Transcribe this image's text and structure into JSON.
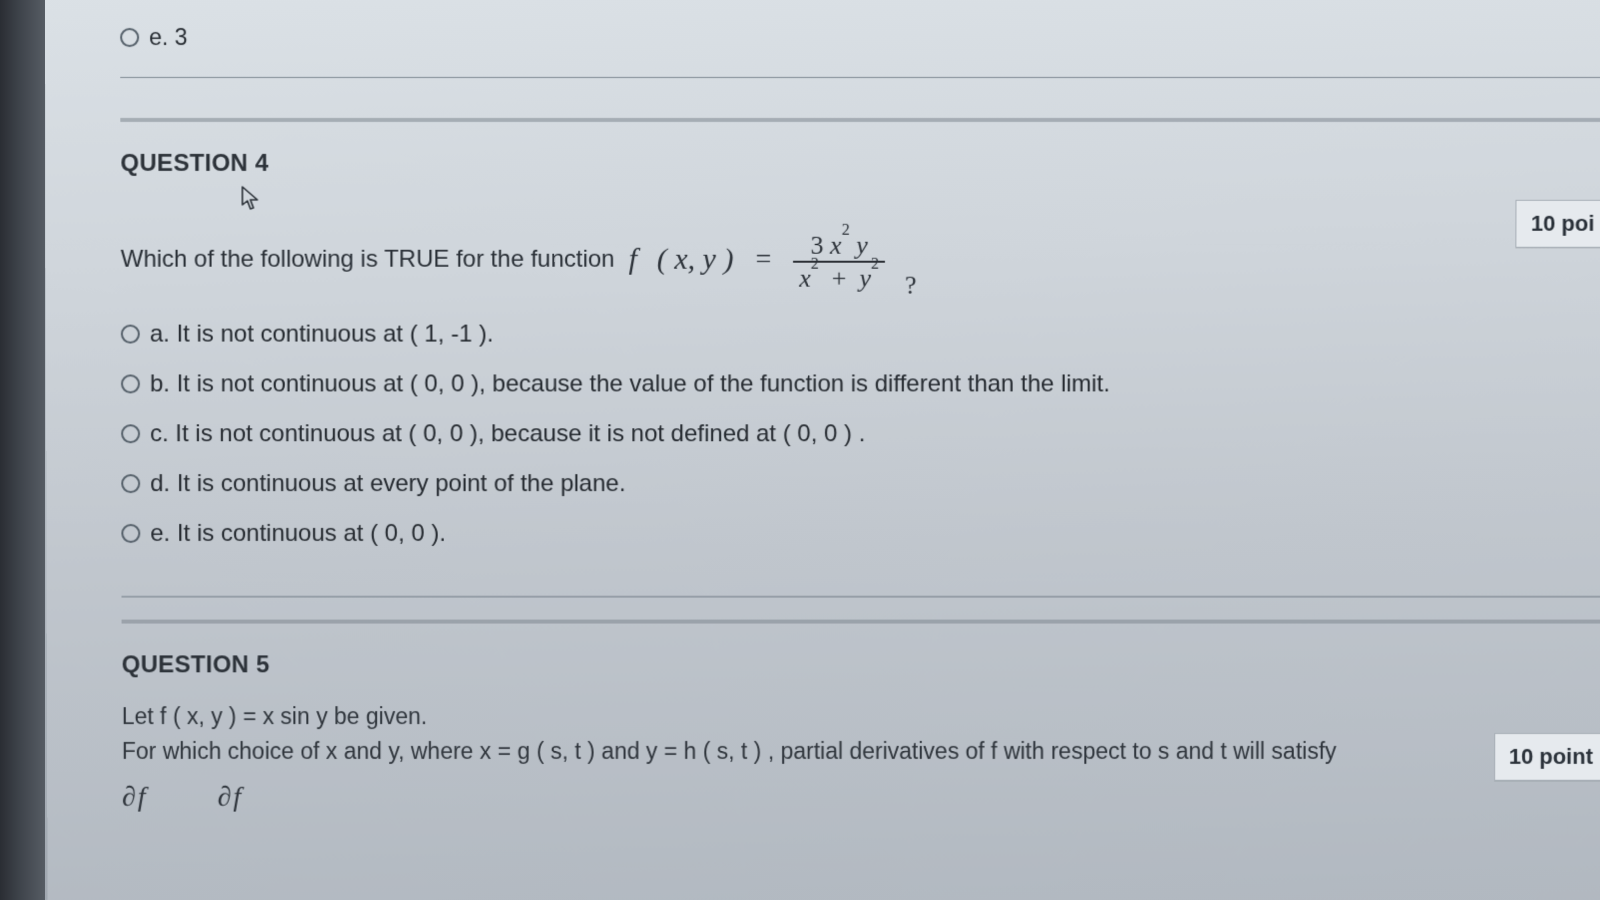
{
  "prev_question": {
    "option_e": "e. 3"
  },
  "question4": {
    "title": "QUESTION 4",
    "points_label": "10 poi",
    "prompt_lead": "Which of the following is TRUE for the function",
    "func_lhs_f": "f",
    "func_lhs_args": "(   x,   y   )",
    "equals": "=",
    "frac_num": "3 x² y",
    "frac_den": "x²  +  y²",
    "qmark": "?",
    "options": {
      "a": "a. It is not continuous at ( 1, -1 ).",
      "b": "b. It is not continuous at ( 0, 0 ), because the value of the function is different than the limit.",
      "c": "c. It is not continuous at ( 0, 0 ), because it is not defined at ( 0, 0 ) .",
      "d": "d. It is continuous at every point of the plane.",
      "e": "e. It is continuous at ( 0, 0 )."
    }
  },
  "question5": {
    "title": "QUESTION 5",
    "points_label": "10 point",
    "line1": "Let f ( x, y ) = x sin y be given.",
    "line2": "For which choice of x and y,  where x = g ( s, t ) and y = h ( s, t ) ,  partial derivatives of f with respect to s and t will satisfy",
    "partial1": "∂f",
    "partial2": "∂f"
  }
}
